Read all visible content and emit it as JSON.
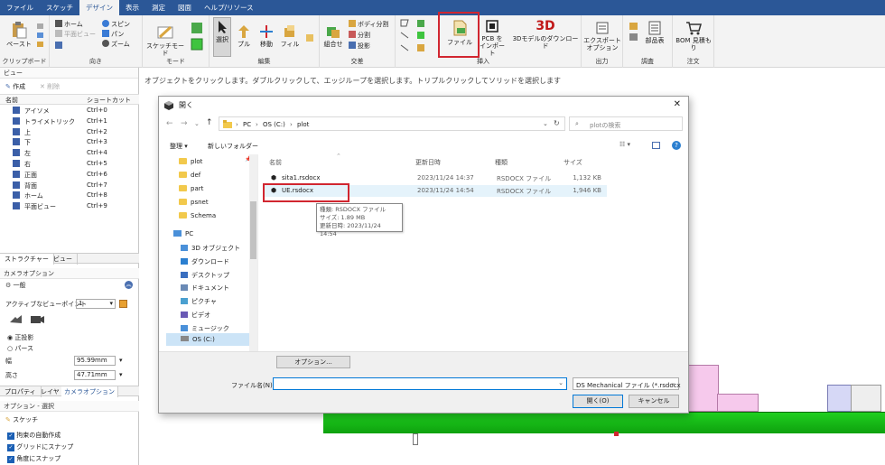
{
  "menu": [
    "ファイル",
    "スケッチ",
    "デザイン",
    "表示",
    "測定",
    "図面",
    "ヘルプ/リソース"
  ],
  "ribbon": {
    "clipboard": {
      "label": "クリップボード",
      "paste": "ペースト"
    },
    "orient": {
      "label": "向き",
      "home": "ホーム",
      "plane": "平面ビュー",
      "spin": "スピン",
      "pan": "パン",
      "zoom": "ズーム"
    },
    "mode": {
      "label": "モード",
      "sketch": "スケッチモード"
    },
    "edit": {
      "label": "編集",
      "select": "選択",
      "pull": "プル",
      "move": "移動",
      "fill": "フィル"
    },
    "intersect": {
      "label": "交差",
      "combine": "組合せ",
      "split_body": "ボディ分割",
      "split": "分割",
      "project": "投影"
    },
    "insert": {
      "label": "挿入",
      "file": "ファイル",
      "pcb": "PCB をインポート",
      "model3d": "3Dモデルのダウンロード",
      "model3d_icon": "3D"
    },
    "output": {
      "label": "出力",
      "export": "エクスポート オプション"
    },
    "survey": {
      "label": "調査",
      "parts": "部品表"
    },
    "order": {
      "label": "注文",
      "bom": "BOM 見積もり"
    }
  },
  "status_message": "オブジェクトをクリックします。ダブルクリックして、エッジループを選択します。トリプルクリックしてソリッドを選択します",
  "left_panel": {
    "view_title": "ビュー",
    "create": "作成",
    "delete": "削除",
    "col_name": "名前",
    "col_shortcut": "ショートカット",
    "views": [
      {
        "name": "アイソメ",
        "key": "Ctrl+0"
      },
      {
        "name": "トライメトリック",
        "key": "Ctrl+1"
      },
      {
        "name": "上",
        "key": "Ctrl+2"
      },
      {
        "name": "下",
        "key": "Ctrl+3"
      },
      {
        "name": "左",
        "key": "Ctrl+4"
      },
      {
        "name": "右",
        "key": "Ctrl+5"
      },
      {
        "name": "正面",
        "key": "Ctrl+6"
      },
      {
        "name": "背面",
        "key": "Ctrl+7"
      },
      {
        "name": "ホーム",
        "key": "Ctrl+8"
      },
      {
        "name": "平面ビュー",
        "key": "Ctrl+9"
      }
    ],
    "tabs": [
      "ストラクチャー",
      "ビュー"
    ],
    "camera_options": "カメラオプション",
    "general": "一般",
    "active_viewpoint": "アクティブなビューポイント",
    "viewpoint_value": "1",
    "ortho": "正投影",
    "perspective": "パース",
    "width_label": "幅",
    "width_value": "95.99mm",
    "height_label": "高さ",
    "height_value": "47.71mm",
    "bottom_tabs": [
      "プロパティ",
      "レイヤ",
      "カメラオプション"
    ],
    "options_select": "オプション - 選択",
    "sketch": "スケッチ",
    "checks": [
      "拘束の自動作成",
      "グリッドにスナップ",
      "角度にスナップ"
    ]
  },
  "dialog": {
    "title": "開く",
    "breadcrumb": [
      "PC",
      "OS (C:)",
      "plot"
    ],
    "search_placeholder": "plotの検索",
    "organize": "整理",
    "new_folder": "新しいフォルダー",
    "headers": [
      "名前",
      "更新日時",
      "種類",
      "サイズ"
    ],
    "files": [
      {
        "name": "sita1.rsdocx",
        "date": "2023/11/24 14:37",
        "type": "RSDOCX ファイル",
        "size": "1,132 KB"
      },
      {
        "name": "UE.rsdocx",
        "date": "2023/11/24 14:54",
        "type": "RSDOCX ファイル",
        "size": "1,946 KB"
      }
    ],
    "tooltip": [
      "種類: RSDOCX ファイル",
      "サイズ: 1.89 MB",
      "更新日時: 2023/11/24 14:54"
    ],
    "tree_folders": [
      "plot",
      "def",
      "part",
      "psnet",
      "Schema"
    ],
    "tree_pc": "PC",
    "tree_items": [
      "3D オブジェクト",
      "ダウンロード",
      "デスクトップ",
      "ドキュメント",
      "ピクチャ",
      "ビデオ",
      "ミュージック",
      "OS (C:)"
    ],
    "options_btn": "オプション...",
    "filename_label": "ファイル名(N):",
    "filename_value": "",
    "filetype": "DS Mechanical ファイル (*.rsdocx",
    "open_btn": "開く(O)",
    "cancel_btn": "キャンセル"
  }
}
